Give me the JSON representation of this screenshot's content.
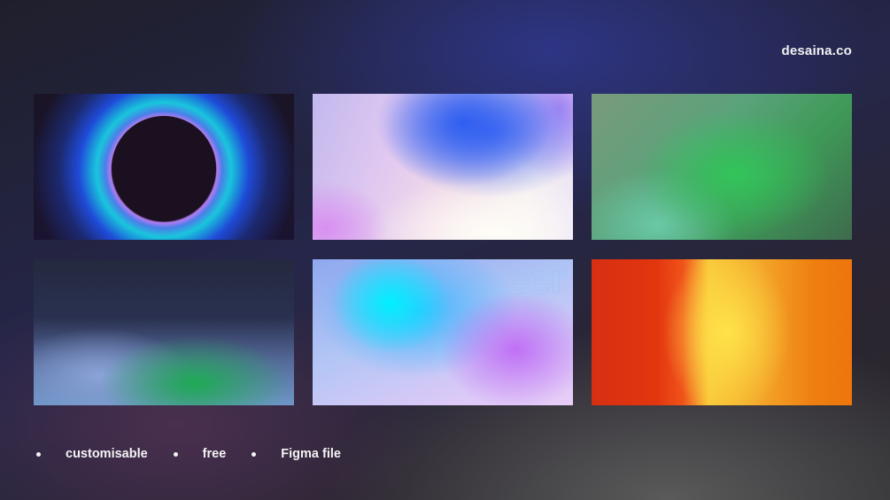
{
  "brand": {
    "name": "desaina.co"
  },
  "tiles": [
    {
      "name": "eclipse-gradient"
    },
    {
      "name": "pastel-blue-gradient"
    },
    {
      "name": "green-gradient"
    },
    {
      "name": "navy-green-gradient"
    },
    {
      "name": "cyan-violet-gradient",
      "watermark": "seer"
    },
    {
      "name": "orange-gradient"
    }
  ],
  "features": [
    {
      "label": "customisable"
    },
    {
      "label": "free"
    },
    {
      "label": "Figma file"
    }
  ],
  "colors": {
    "text": "#f4f4f4",
    "background": "#25264a"
  }
}
